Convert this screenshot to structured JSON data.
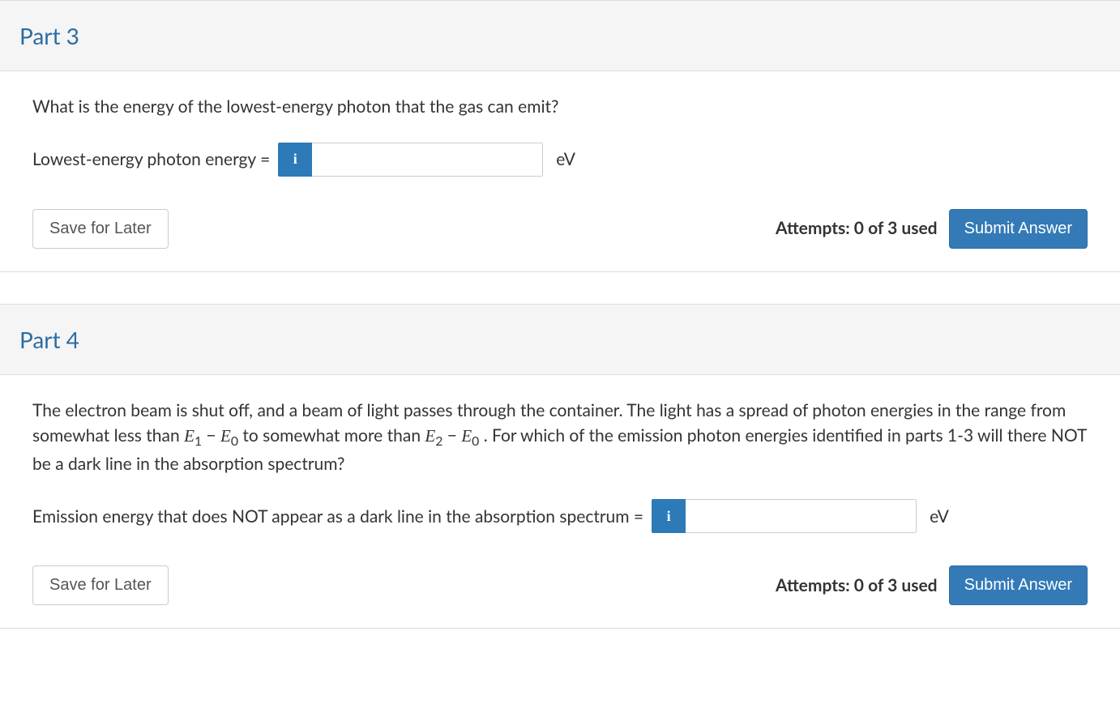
{
  "part3": {
    "title": "Part 3",
    "question": "What is the energy of the lowest-energy photon that the gas can emit?",
    "label": "Lowest-energy photon energy =",
    "info_icon": "i",
    "input_value": "",
    "unit": "eV",
    "save_label": "Save for Later",
    "attempts": "Attempts: 0 of 3 used",
    "submit_label": "Submit Answer"
  },
  "part4": {
    "title": "Part 4",
    "question_pre": "The electron beam is shut off, and a beam of light passes through the container. The light has a spread of photon energies in the range from somewhat less than ",
    "math1_E": "E",
    "math1_s1": "1",
    "minus": " − ",
    "math1_s0": "0",
    "question_mid": " to somewhat more than ",
    "math2_s2": "2",
    "question_post": ". For which of the emission photon energies identified in parts 1-3 will there NOT be a dark line in the absorption spectrum?",
    "label": "Emission energy that does NOT appear as a dark line in the absorption spectrum =",
    "info_icon": "i",
    "input_value": "",
    "unit": "eV",
    "save_label": "Save for Later",
    "attempts": "Attempts: 0 of 3 used",
    "submit_label": "Submit Answer"
  }
}
